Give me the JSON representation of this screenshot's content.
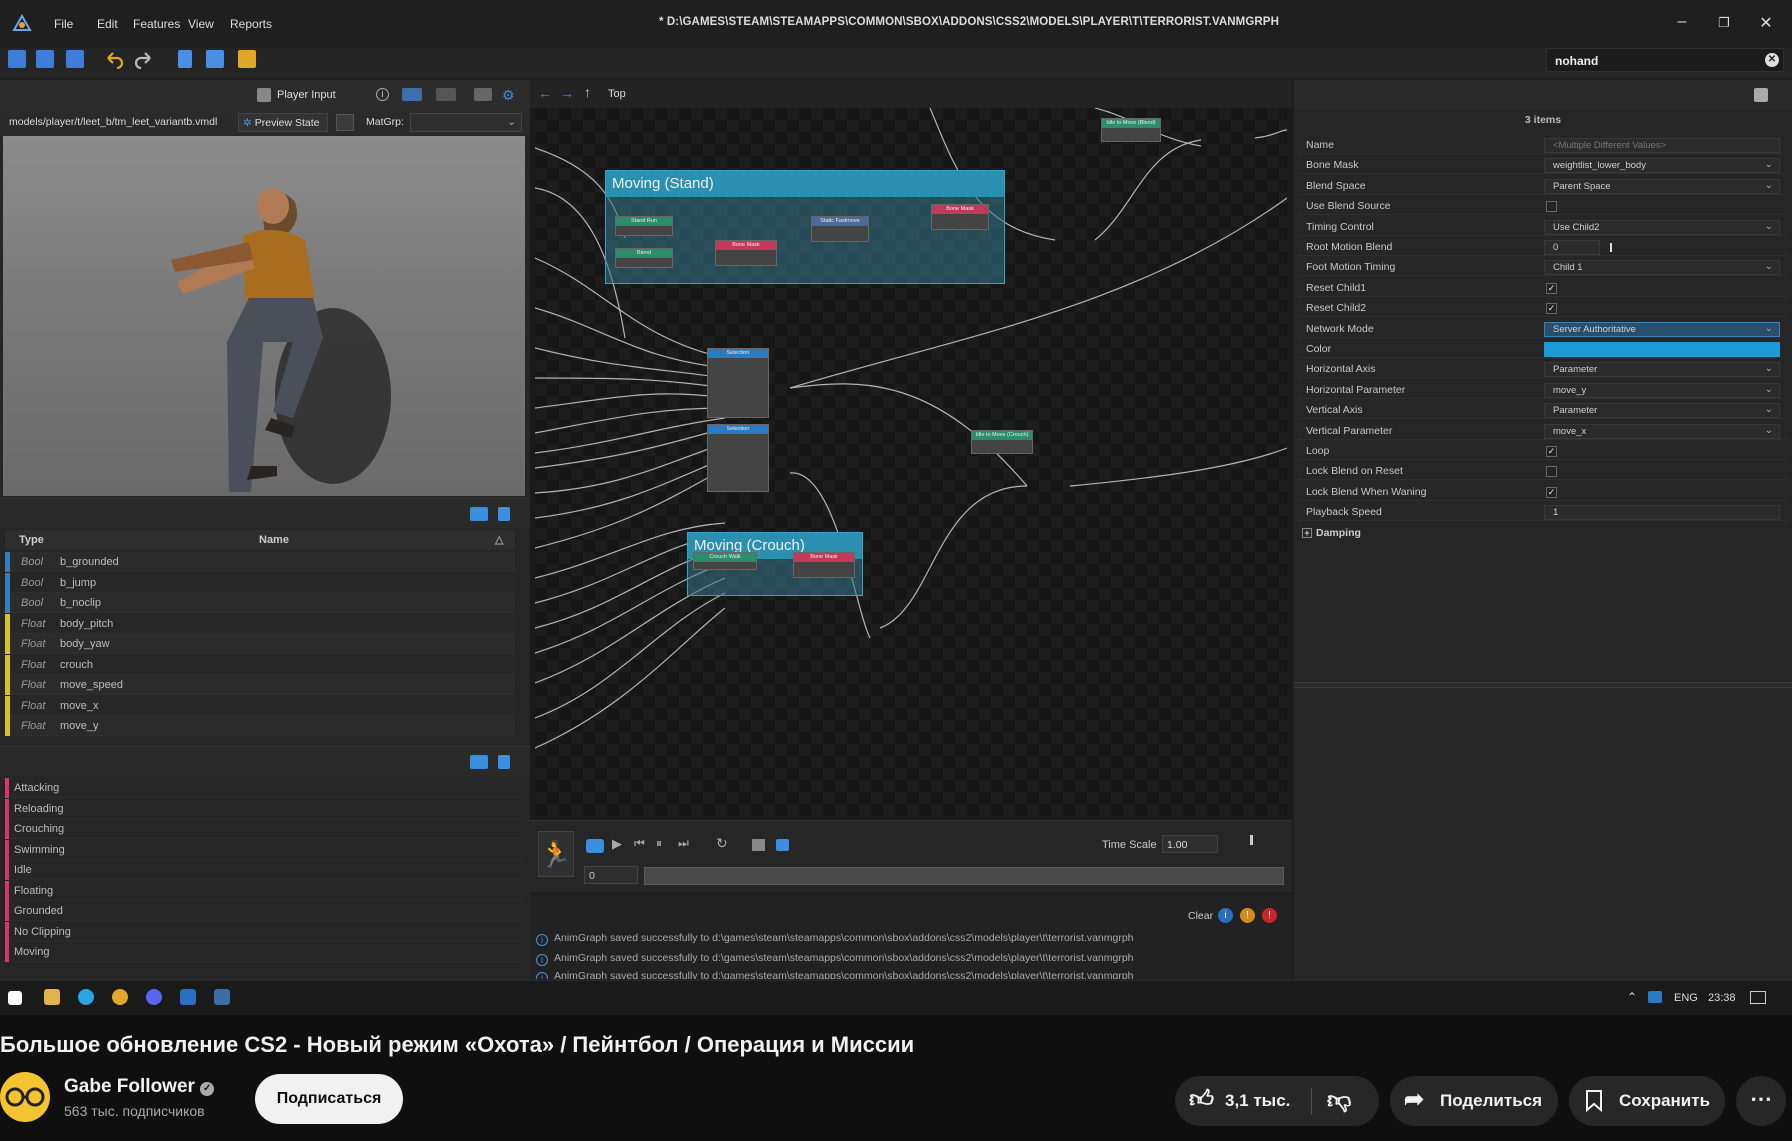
{
  "window": {
    "title": "* D:\\GAMES\\STEAM\\STEAMAPPS\\COMMON\\SBOX\\ADDONS\\CSS2\\MODELS\\PLAYER\\T\\TERRORIST.VANMGRPH",
    "menu": [
      "File",
      "Edit",
      "Features",
      "View",
      "Reports"
    ],
    "controls": [
      "–",
      "❐",
      "✕"
    ]
  },
  "search": {
    "value": "nohand"
  },
  "left": {
    "player_input": "Player Input",
    "model_path": "models/player/t/leet_b/tm_leet_variantb.vmdl",
    "preview_state": "Preview State",
    "matgrp": "MatGrp:",
    "params_header": {
      "type": "Type",
      "name": "Name"
    },
    "params": [
      {
        "type": "Bool",
        "name": "b_grounded",
        "color": "#2f7fc1"
      },
      {
        "type": "Bool",
        "name": "b_jump",
        "color": "#2f7fc1"
      },
      {
        "type": "Bool",
        "name": "b_noclip",
        "color": "#2f7fc1"
      },
      {
        "type": "Float",
        "name": "body_pitch",
        "color": "#d4c228"
      },
      {
        "type": "Float",
        "name": "body_yaw",
        "color": "#d4c228"
      },
      {
        "type": "Float",
        "name": "crouch",
        "color": "#d4c228"
      },
      {
        "type": "Float",
        "name": "move_speed",
        "color": "#d4c228"
      },
      {
        "type": "Float",
        "name": "move_x",
        "color": "#d4c228"
      },
      {
        "type": "Float",
        "name": "move_y",
        "color": "#d4c228"
      }
    ],
    "states": [
      "Attacking",
      "Reloading",
      "Crouching",
      "Swimming",
      "Idle",
      "Floating",
      "Grounded",
      "No Clipping",
      "Moving"
    ]
  },
  "graph": {
    "breadcrumb": "Top",
    "groups": {
      "stand": "Moving (Stand)",
      "crouch": "Moving (Crouch)"
    },
    "nodes": {
      "stand_run": "Stand Run",
      "blend_a": "Blend",
      "bone_mask_1": "Bone Mask",
      "static_fastmove": "Static Fastmove",
      "bone_mask_2": "Bone Mask",
      "selection_1": "Selection",
      "selection_2": "Selection",
      "idle_to_move_blend": "Idle to Move (Blend)",
      "idle_to_move_crouch": "Idle to Move (Crouch)",
      "crouch_walk": "Crouch Walk",
      "bone_mask_3": "Bone Mask"
    }
  },
  "playbar": {
    "time_scale_label": "Time Scale",
    "time_scale": "1.00",
    "frame": "0"
  },
  "console": {
    "clear": "Clear",
    "lines": [
      "AnimGraph saved successfully to d:\\games\\steam\\steamapps\\common\\sbox\\addons\\css2\\models\\player\\t\\terrorist.vanmgrph",
      "AnimGraph saved successfully to d:\\games\\steam\\steamapps\\common\\sbox\\addons\\css2\\models\\player\\t\\terrorist.vanmgrph",
      "AnimGraph saved successfully to d:\\games\\steam\\steamapps\\common\\sbox\\addons\\css2\\models\\player\\t\\terrorist.vanmgrph"
    ]
  },
  "props": {
    "items_count": "3 items",
    "rows": [
      {
        "label": "Name",
        "value": "<Multiple Different Values>",
        "kind": "text"
      },
      {
        "label": "Bone Mask",
        "value": "weightlist_lower_body",
        "kind": "select"
      },
      {
        "label": "Blend Space",
        "value": "Parent Space",
        "kind": "select"
      },
      {
        "label": "Use Blend Source",
        "value": "",
        "kind": "check",
        "checked": false
      },
      {
        "label": "Timing Control",
        "value": "Use Child2",
        "kind": "select"
      },
      {
        "label": "Root Motion Blend",
        "value": "0",
        "kind": "slider"
      },
      {
        "label": "Foot Motion Timing",
        "value": "Child 1",
        "kind": "select"
      },
      {
        "label": "Reset Child1",
        "value": "",
        "kind": "check",
        "checked": true
      },
      {
        "label": "Reset Child2",
        "value": "",
        "kind": "check",
        "checked": true
      },
      {
        "label": "Network Mode",
        "value": "Server Authoritative",
        "kind": "select"
      },
      {
        "label": "Color",
        "value": "",
        "kind": "color"
      },
      {
        "label": "Horizontal Axis",
        "value": "Parameter",
        "kind": "select"
      },
      {
        "label": "Horizontal Parameter",
        "value": "move_y",
        "kind": "select"
      },
      {
        "label": "Vertical Axis",
        "value": "Parameter",
        "kind": "select"
      },
      {
        "label": "Vertical Parameter",
        "value": "move_x",
        "kind": "select"
      },
      {
        "label": "Loop",
        "value": "",
        "kind": "check",
        "checked": true
      },
      {
        "label": "Lock Blend on Reset",
        "value": "",
        "kind": "check",
        "checked": false
      },
      {
        "label": "Lock Blend When Waning",
        "value": "",
        "kind": "check",
        "checked": true
      },
      {
        "label": "Playback Speed",
        "value": "1",
        "kind": "text"
      }
    ],
    "damping": "Damping"
  },
  "taskbar": {
    "lang": "ENG",
    "time": "23:38"
  },
  "youtube": {
    "title": "Большое обновление CS2 - Новый режим «Охота» / Пейнтбол / Операция и Миссии",
    "channel": "Gabe Follower",
    "subscribers": "563 тыс. подписчиков",
    "subscribe": "Подписаться",
    "likes": "3,1 тыс.",
    "share": "Поделиться",
    "save": "Сохранить"
  }
}
